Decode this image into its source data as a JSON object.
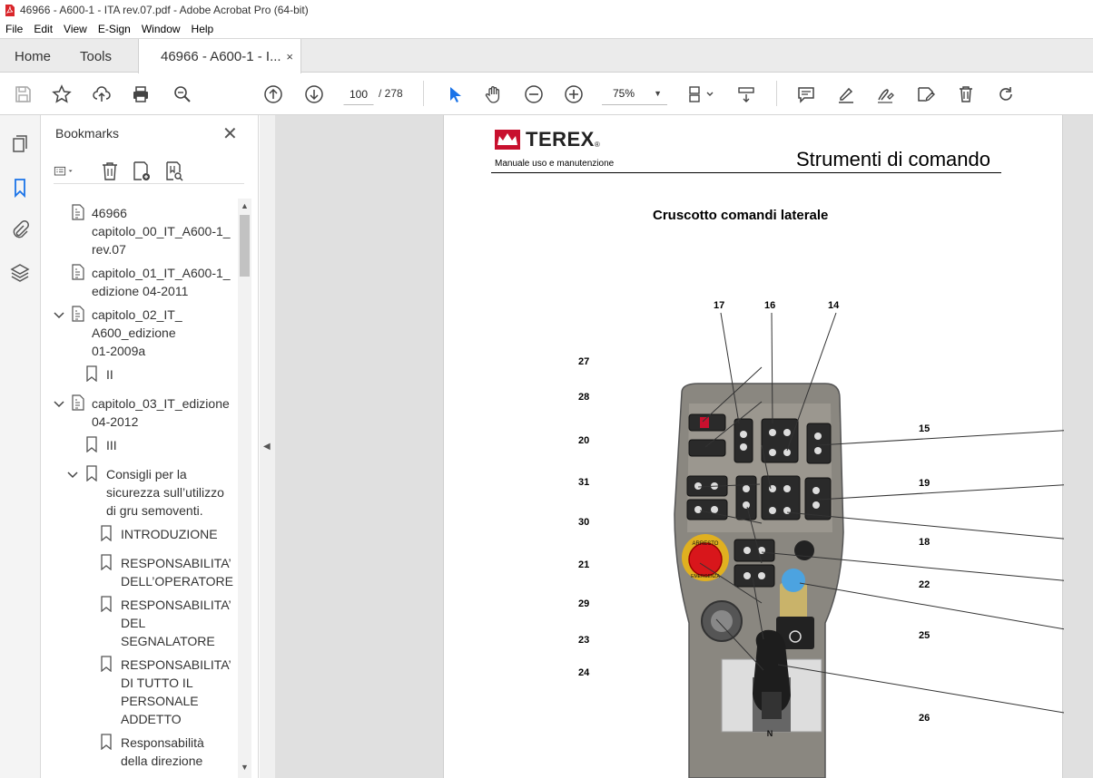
{
  "window": {
    "title": "46966 - A600-1 - ITA rev.07.pdf - Adobe Acrobat Pro (64-bit)"
  },
  "menu": [
    "File",
    "Edit",
    "View",
    "E-Sign",
    "Window",
    "Help"
  ],
  "tabs": {
    "home": "Home",
    "tools": "Tools",
    "doc": "46966 - A600-1 - I...",
    "doc_close": "×"
  },
  "toolbar": {
    "page_current": "100",
    "page_total": "/ 278",
    "zoom": "75%"
  },
  "panel": {
    "title": "Bookmarks",
    "close": "✕",
    "items": [
      {
        "label": "46966\ncapitolo_00_IT_A600-1_\nrev.07",
        "type": "doc"
      },
      {
        "label": "capitolo_01_IT_A600-1_\nedizione 04-2011",
        "type": "doc"
      },
      {
        "label": "capitolo_02_IT_\nA600_edizione\n01-2009a",
        "type": "doc"
      },
      {
        "label": "II",
        "type": "bookmark"
      },
      {
        "label": "capitolo_03_IT_edizione\n04-2012",
        "type": "doc"
      },
      {
        "label": "III",
        "type": "bookmark"
      },
      {
        "label": "Consigli per la\nsicurezza sull’utilizzo\ndi gru semoventi.",
        "type": "bookmark"
      },
      {
        "label": "INTRODUZIONE",
        "type": "bookmark"
      },
      {
        "label": "RESPONSABILITA’\nDELL’OPERATORE",
        "type": "bookmark"
      },
      {
        "label": "RESPONSABILITA’\nDEL\nSEGNALATORE",
        "type": "bookmark"
      },
      {
        "label": "RESPONSABILITA’\nDI TUTTO IL\nPERSONALE\nADDETTO",
        "type": "bookmark"
      },
      {
        "label": "Responsabilità\ndella direzione",
        "type": "bookmark"
      }
    ]
  },
  "document": {
    "brand": "TEREX",
    "brand_mark": "®",
    "subtitle": "Manuale uso e manutenzione",
    "section": "Strumenti di comando",
    "figure_title": "Cruscotto comandi laterale",
    "panel_labels": {
      "arresto": "ARRESTO",
      "emergenza": "EMERGENZA"
    },
    "callouts": [
      "17",
      "16",
      "14",
      "27",
      "28",
      "20",
      "31",
      "30",
      "21",
      "29",
      "23",
      "24",
      "15",
      "19",
      "18",
      "22",
      "25",
      "26"
    ]
  }
}
